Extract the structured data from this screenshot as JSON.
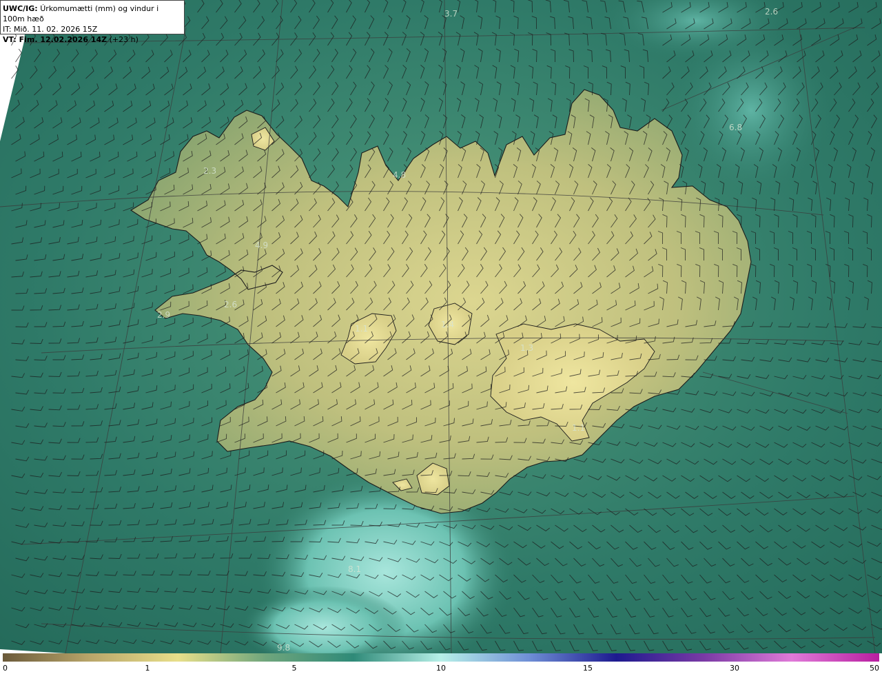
{
  "header": {
    "model_label": "UWC/IG:",
    "product": "Úrkomumætti (mm) og vindur i 100m hæð",
    "initial_time": "IT: Mið. 11. 02. 2026 15Z",
    "valid_label": "VT: Fim. 12.02.2026 14Z",
    "lead": "(+23 h)"
  },
  "colorbar": {
    "ticks": [
      "0",
      "1",
      "5",
      "10",
      "15",
      "30",
      "50"
    ],
    "stops": [
      "#6b5a3a",
      "#b9a66a",
      "#e8df8a",
      "#6fa57c",
      "#2f8a78",
      "#b7f0e8",
      "#6f8fd6",
      "#1d1a8f",
      "#7a3aa5",
      "#e07ad8",
      "#b81ea0"
    ]
  },
  "map": {
    "colors": {
      "sea": "#2f7a68",
      "sea_dark": "#246a5a",
      "sea_light": "#7fd0c4",
      "land": "#b9bd7a",
      "land_high": "#d6d48c",
      "coast": "#1b1b1b",
      "grid": "#3b3b3b",
      "barb": "#1c1c1c"
    },
    "value_labels": [
      "3.7",
      "2.6",
      "6.8",
      "2.3",
      "4.8",
      "4.9",
      "2.6",
      "2.9",
      "1.1",
      "1.4",
      "1.3",
      "1.1",
      "8.1",
      "9.8"
    ]
  }
}
